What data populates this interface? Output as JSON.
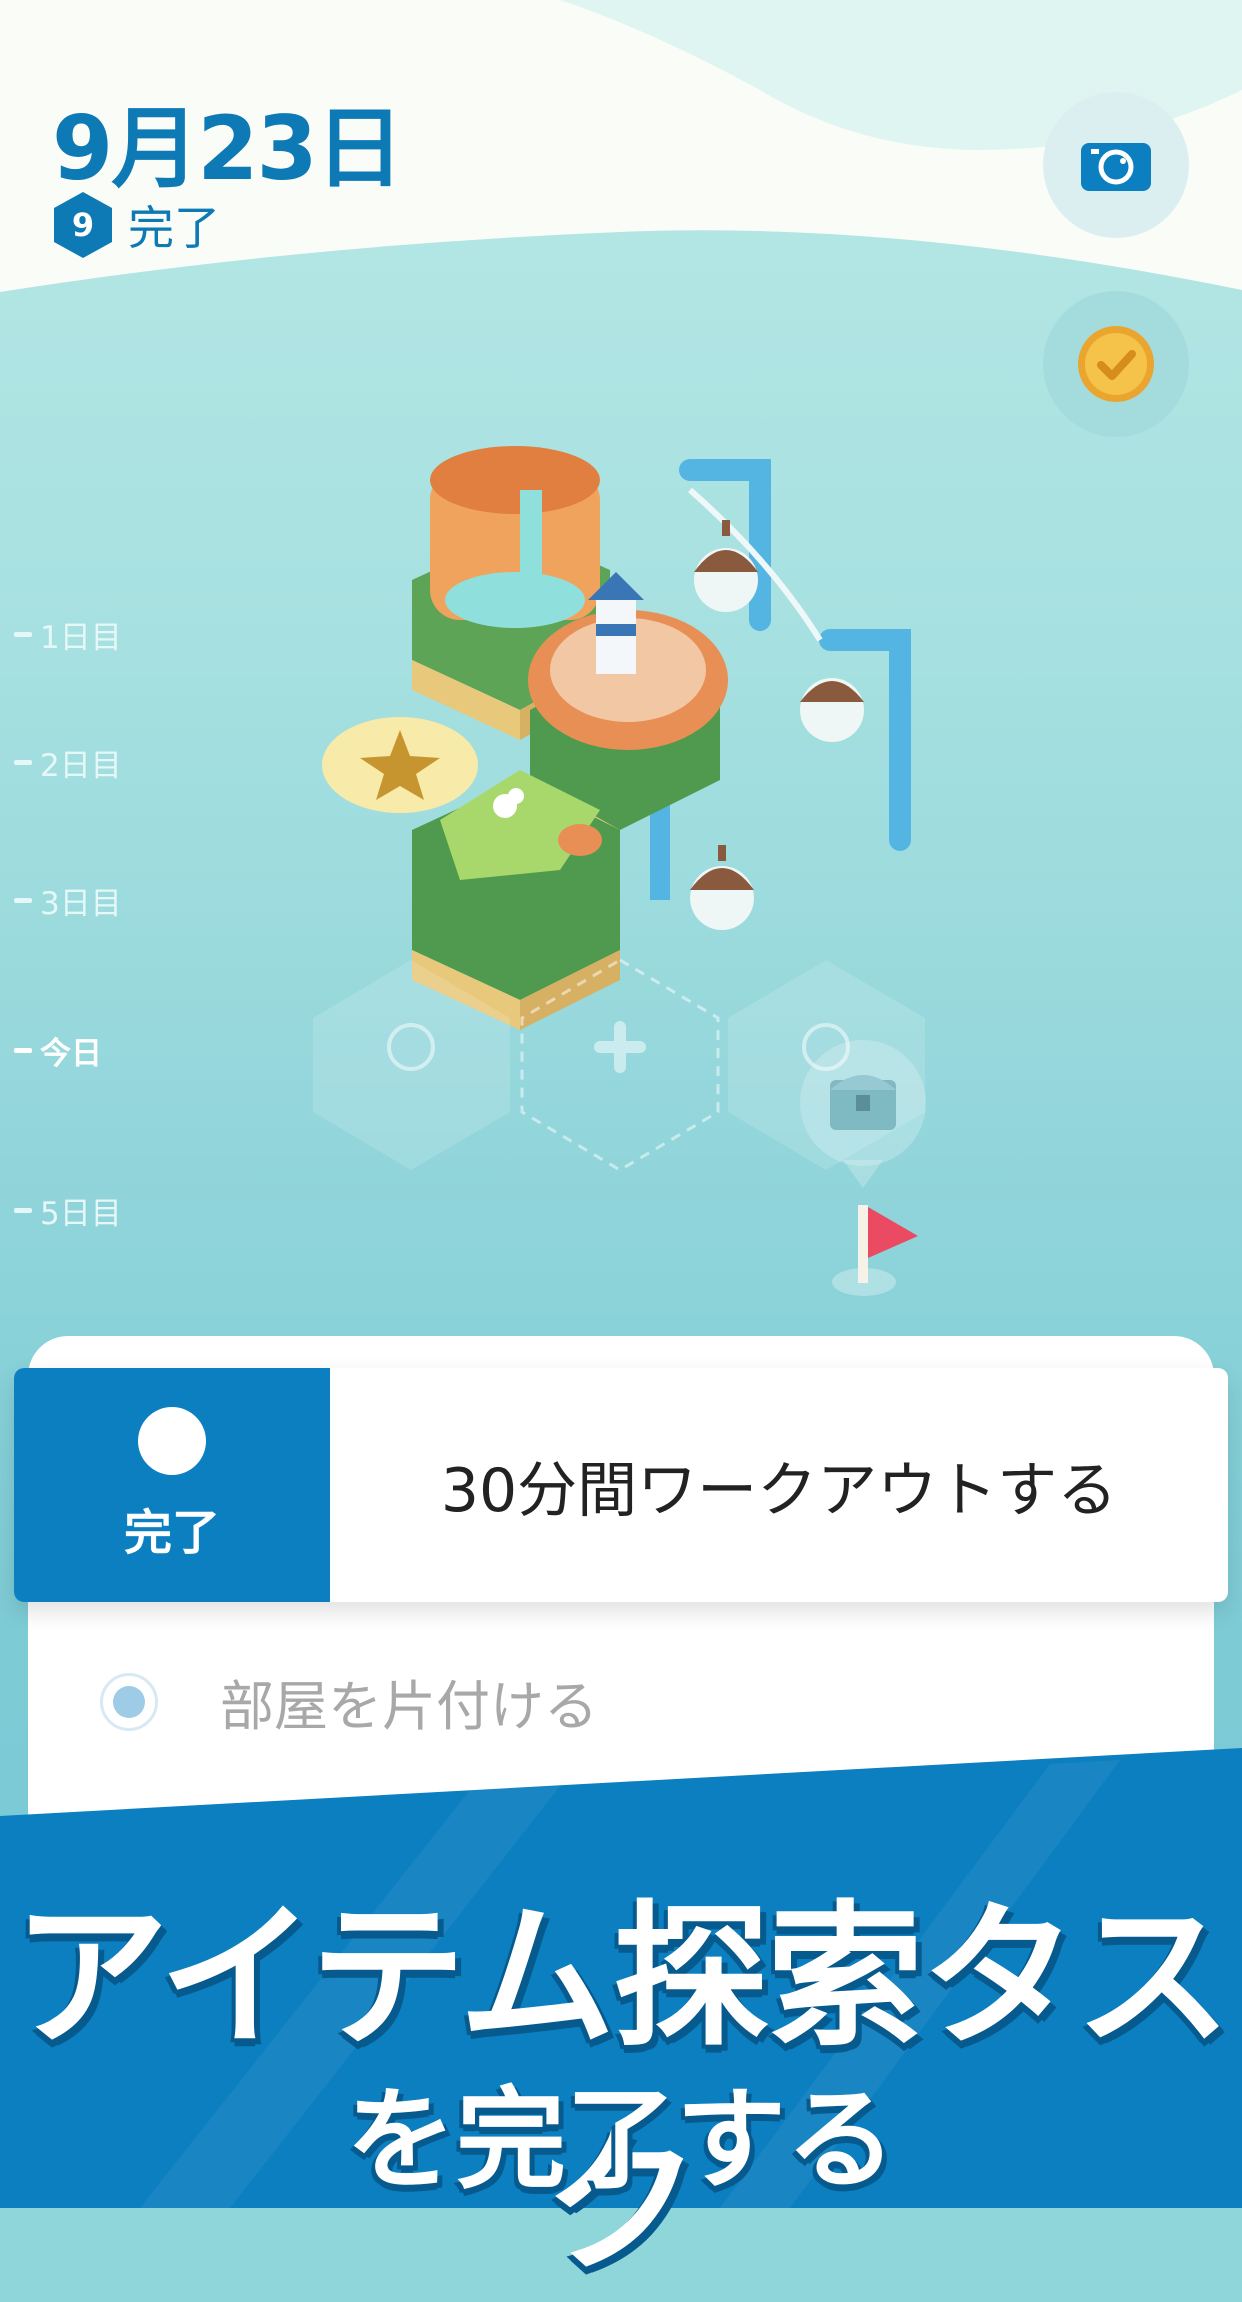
{
  "header": {
    "date": "9月23日",
    "completed_count": "9",
    "completed_label": "完了"
  },
  "timeline": {
    "items": [
      {
        "label": "1日目"
      },
      {
        "label": "2日目"
      },
      {
        "label": "3日目"
      },
      {
        "label": "今日"
      },
      {
        "label": "5日目"
      }
    ]
  },
  "actions": {
    "camera_icon": "camera-icon",
    "check_icon": "check-coin-icon"
  },
  "tasks": {
    "current": {
      "button_label": "完了",
      "text": "30分間ワークアウトする"
    },
    "next": {
      "text": "部屋を片付ける"
    }
  },
  "banner": {
    "line1": "アイテム探索タスク",
    "line2": "を完了する"
  },
  "colors": {
    "brand_blue": "#0b7fc0",
    "title_blue": "#0d79b5",
    "sea": "#8fd4da",
    "coin_gold": "#f1b73b",
    "flag_red": "#ea4a62"
  }
}
